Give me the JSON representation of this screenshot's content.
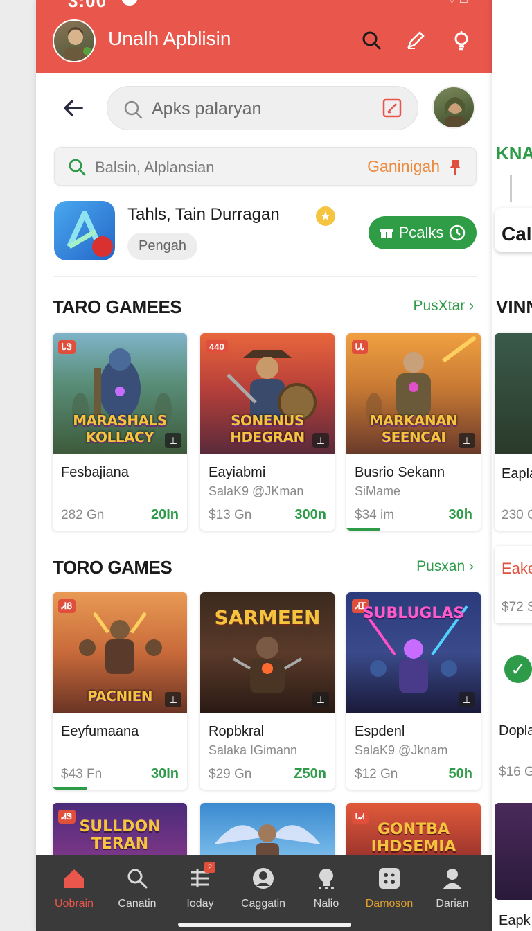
{
  "status": {
    "time": "3:00"
  },
  "header": {
    "app_title": "Unalh Apblisin"
  },
  "search": {
    "placeholder": "Apks palaryan"
  },
  "sub_search": {
    "placeholder": "Balsin, Alplansian",
    "hint": "Ganinigah"
  },
  "featured": {
    "title": "Tahls, Tain Durragan",
    "chip": "Pengah",
    "button": "Pcalks"
  },
  "sections": [
    {
      "title": "TARO GAMEES",
      "link": "PusXtar",
      "cards": [
        {
          "badge": "ᏓᏕ",
          "art_title": "MARASHALS KOLLACY",
          "name": "Fesbajiana",
          "dev": "",
          "price": "282 Gn",
          "time": "20In",
          "progress": 0
        },
        {
          "badge": "440",
          "art_title": "SONENUS HDEGRAN",
          "name": "Eayiabmi",
          "dev": "SalaK9 @JKman",
          "price": "$13 Gn",
          "time": "300n",
          "progress": 0
        },
        {
          "badge": "ᏓᏓ",
          "art_title": "MARKANAN SEENCAI",
          "name": "Busrio Sekann",
          "dev": "SiMame",
          "price": "$34 im",
          "time": "30h",
          "progress": 0.25
        }
      ]
    },
    {
      "title": "TORO GAMES",
      "link": "Pusxan",
      "cards": [
        {
          "badge": "ᏗᏰ",
          "art_title": "PACNIEN",
          "name": "Eeyfumaana",
          "dev": "",
          "price": "$43 Fn",
          "time": "30In",
          "progress": 0.25
        },
        {
          "badge": "",
          "art_title": "SARMEEN",
          "name": "Ropbkral",
          "dev": "Salaka IGimann",
          "price": "$29 Gn",
          "time": "Z50n",
          "progress": 0
        },
        {
          "badge": "ᏗᏆ",
          "art_title": "SUBLUGLAS",
          "name": "Espdenl",
          "dev": "SalaK9 @Jknam",
          "price": "$12 Gn",
          "time": "50h",
          "progress": 0
        }
      ]
    }
  ],
  "row3_cards": [
    {
      "badge": "ᏗᏕ",
      "art_title": "SULLDON TERAN"
    },
    {
      "badge": "",
      "art_title": ""
    },
    {
      "badge": "ᏓᏗ",
      "art_title": "GONTBA IHDSEMIA"
    }
  ],
  "nav": [
    {
      "label": "Uobrain",
      "active": true
    },
    {
      "label": "Canatin",
      "active": false
    },
    {
      "label": "Ioday",
      "active": false,
      "badge": "2"
    },
    {
      "label": "Caggatin",
      "active": false
    },
    {
      "label": "Nalio",
      "active": false
    },
    {
      "label": "Damoson",
      "active": false
    },
    {
      "label": "Darian",
      "active": false
    }
  ],
  "peek": {
    "top_label": "KNA",
    "cal": "Cal",
    "section": "VINN",
    "card1_name": "Eapla",
    "card1_price": "230 G",
    "card2_name": "Eake",
    "card2_price": "$72 S",
    "card3_name": "Dopla",
    "card3_price": "$16 G",
    "card4_name": "Eapk"
  },
  "colors": {
    "primary": "#e9564b",
    "accent_green": "#2e9b49",
    "accent_orange": "#ec8a3e",
    "nav_bg": "#3a3a3a"
  }
}
